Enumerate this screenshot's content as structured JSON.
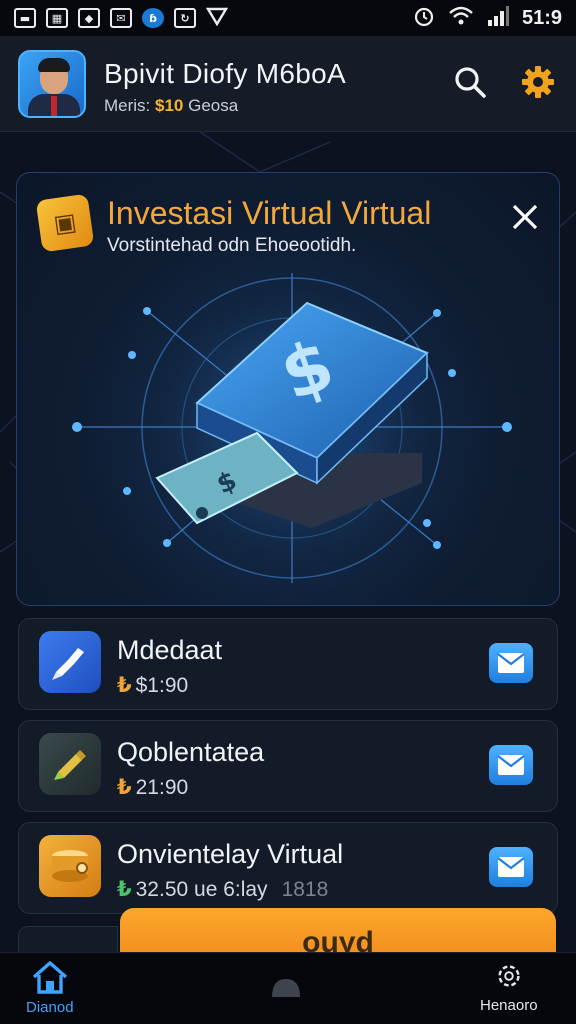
{
  "status_bar": {
    "icons": [
      "image-icon",
      "calendar-icon",
      "alert-icon",
      "mail-icon",
      "notification-dot-icon",
      "sync-icon",
      "location-icon"
    ],
    "right_icons": [
      "alarm-icon",
      "wifi-icon",
      "signal-icon"
    ],
    "time": "51:9"
  },
  "header": {
    "title": "Bpivit Diofy M6boA",
    "subtitle_prefix": "Meris: ",
    "subtitle_value": "$10",
    "subtitle_suffix": " Geosa"
  },
  "hero": {
    "title": "Investasi Virtual Virtual",
    "subtitle": "Vorstintehad odn Ehoeootidh.",
    "badge_icon": "cube-icon",
    "art_icon": "dollar-wallet-icon"
  },
  "items": [
    {
      "name": "Mdedaat",
      "amount": "$1:90",
      "coin": "₺",
      "icon": "rocket-icon"
    },
    {
      "name": "Qoblentatea",
      "amount": "21:90",
      "coin": "₺",
      "icon": "pencil-icon"
    },
    {
      "name": "Onvientelay Virtual",
      "amount": "32.50 ue 6:lay",
      "coin": "₺",
      "icon": "coin-stack-icon",
      "faded_suffix": "1818"
    }
  ],
  "cta": {
    "label": "ouyd"
  },
  "navbar": {
    "home_label": "Dianod",
    "right_label": "Henaoro"
  },
  "colors": {
    "accent_orange": "#f4a83a",
    "accent_blue": "#3fa3ff",
    "background": "#0c1220"
  }
}
